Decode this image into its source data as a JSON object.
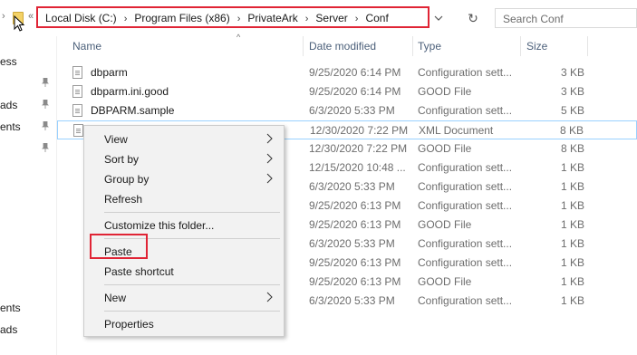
{
  "address_bar": {
    "crumbs": [
      "Local Disk (C:)",
      "Program Files (x86)",
      "PrivateArk",
      "Server",
      "Conf"
    ],
    "separator": "›",
    "back_chevron": "«"
  },
  "search": {
    "placeholder": "Search Conf"
  },
  "nav_pane": {
    "items": [
      "ess",
      "ads",
      "ents",
      "ents",
      "ads"
    ]
  },
  "columns": {
    "name": "Name",
    "date": "Date modified",
    "type": "Type",
    "size": "Size"
  },
  "files": [
    {
      "name": "dbparm",
      "date": "9/25/2020 6:14 PM",
      "type": "Configuration sett...",
      "size": "3 KB"
    },
    {
      "name": "dbparm.ini.good",
      "date": "9/25/2020 6:14 PM",
      "type": "GOOD File",
      "size": "3 KB"
    },
    {
      "name": "DBPARM.sample",
      "date": "6/3/2020 5:33 PM",
      "type": "Configuration sett...",
      "size": "5 KB"
    },
    {
      "name": "",
      "date": "12/30/2020 7:22 PM",
      "type": "XML Document",
      "size": "8 KB"
    },
    {
      "name": "",
      "date": "12/30/2020 7:22 PM",
      "type": "GOOD File",
      "size": "8 KB"
    },
    {
      "name": "",
      "date": "12/15/2020 10:48 ...",
      "type": "Configuration sett...",
      "size": "1 KB"
    },
    {
      "name": "",
      "date": "6/3/2020 5:33 PM",
      "type": "Configuration sett...",
      "size": "1 KB"
    },
    {
      "name": "",
      "date": "9/25/2020 6:13 PM",
      "type": "Configuration sett...",
      "size": "1 KB"
    },
    {
      "name": "",
      "date": "9/25/2020 6:13 PM",
      "type": "GOOD File",
      "size": "1 KB"
    },
    {
      "name": "",
      "date": "6/3/2020 5:33 PM",
      "type": "Configuration sett...",
      "size": "1 KB"
    },
    {
      "name": "",
      "date": "9/25/2020 6:13 PM",
      "type": "Configuration sett...",
      "size": "1 KB"
    },
    {
      "name": "",
      "date": "9/25/2020 6:13 PM",
      "type": "GOOD File",
      "size": "1 KB"
    },
    {
      "name": "",
      "date": "6/3/2020 5:33 PM",
      "type": "Configuration sett...",
      "size": "1 KB"
    }
  ],
  "context_menu": {
    "view": "View",
    "sort_by": "Sort by",
    "group_by": "Group by",
    "refresh": "Refresh",
    "customize": "Customize this folder...",
    "paste": "Paste",
    "paste_shortcut": "Paste shortcut",
    "new": "New",
    "properties": "Properties"
  },
  "colors": {
    "highlight_red": "#e02435",
    "hover_border": "#99d1ff",
    "header_text": "#4c607a"
  }
}
